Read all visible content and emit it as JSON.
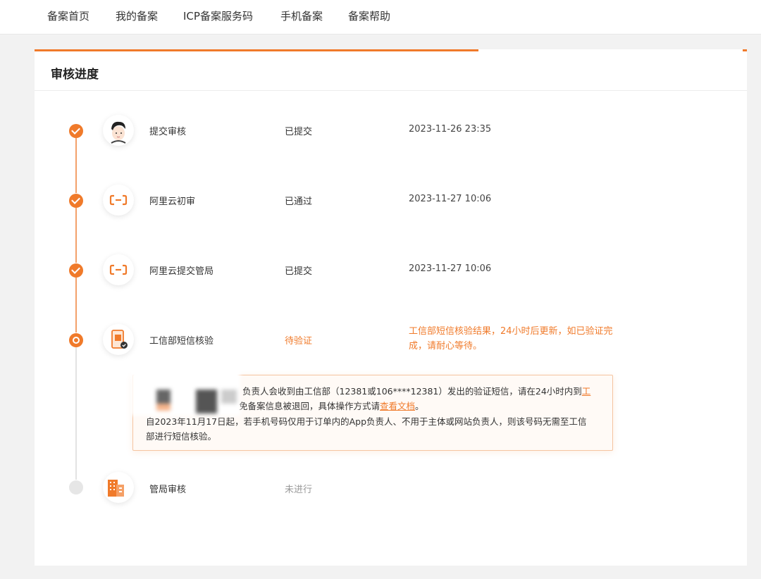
{
  "nav": {
    "items": [
      "备案首页",
      "我的备案",
      "ICP备案服务码",
      "手机备案",
      "备案帮助"
    ]
  },
  "card": {
    "title": "审核进度"
  },
  "steps": [
    {
      "name": "提交审核",
      "status": "已提交",
      "time": "2023-11-26 23:35",
      "state": "done",
      "icon": "avatar-icon"
    },
    {
      "name": "阿里云初审",
      "status": "已通过",
      "time": "2023-11-27 10:06",
      "state": "done",
      "icon": "aliyun-logo-icon"
    },
    {
      "name": "阿里云提交管局",
      "status": "已提交",
      "time": "2023-11-27 10:06",
      "state": "done",
      "icon": "aliyun-logo-icon"
    },
    {
      "name": "工信部短信核验",
      "status": "待验证",
      "note": "工信部短信核验结果，24小时后更新，如已验证完成，请耐心等待。",
      "state": "current",
      "icon": "phone-verify-icon"
    },
    {
      "name": "管局审核",
      "status": "未进行",
      "state": "pending",
      "icon": "building-icon"
    }
  ],
  "notice": {
    "line1_prefix": "负责人会收到由工信部（12381或106****12381）发出的验证短信，请在24小时内到",
    "line1_link": "工",
    "line2_prefix": "免备案信息被退回，具体操作方式请",
    "line2_link": "查看文档",
    "line2_suffix": "。",
    "line3": "自2023年11月17日起，若手机号码仅用于订单内的App负责人、不用于主体或网站负责人，则该号码无需至工信",
    "line4": "部进行短信核验。"
  },
  "colors": {
    "accent": "#f07a2a",
    "pending": "#e6e6e6"
  }
}
